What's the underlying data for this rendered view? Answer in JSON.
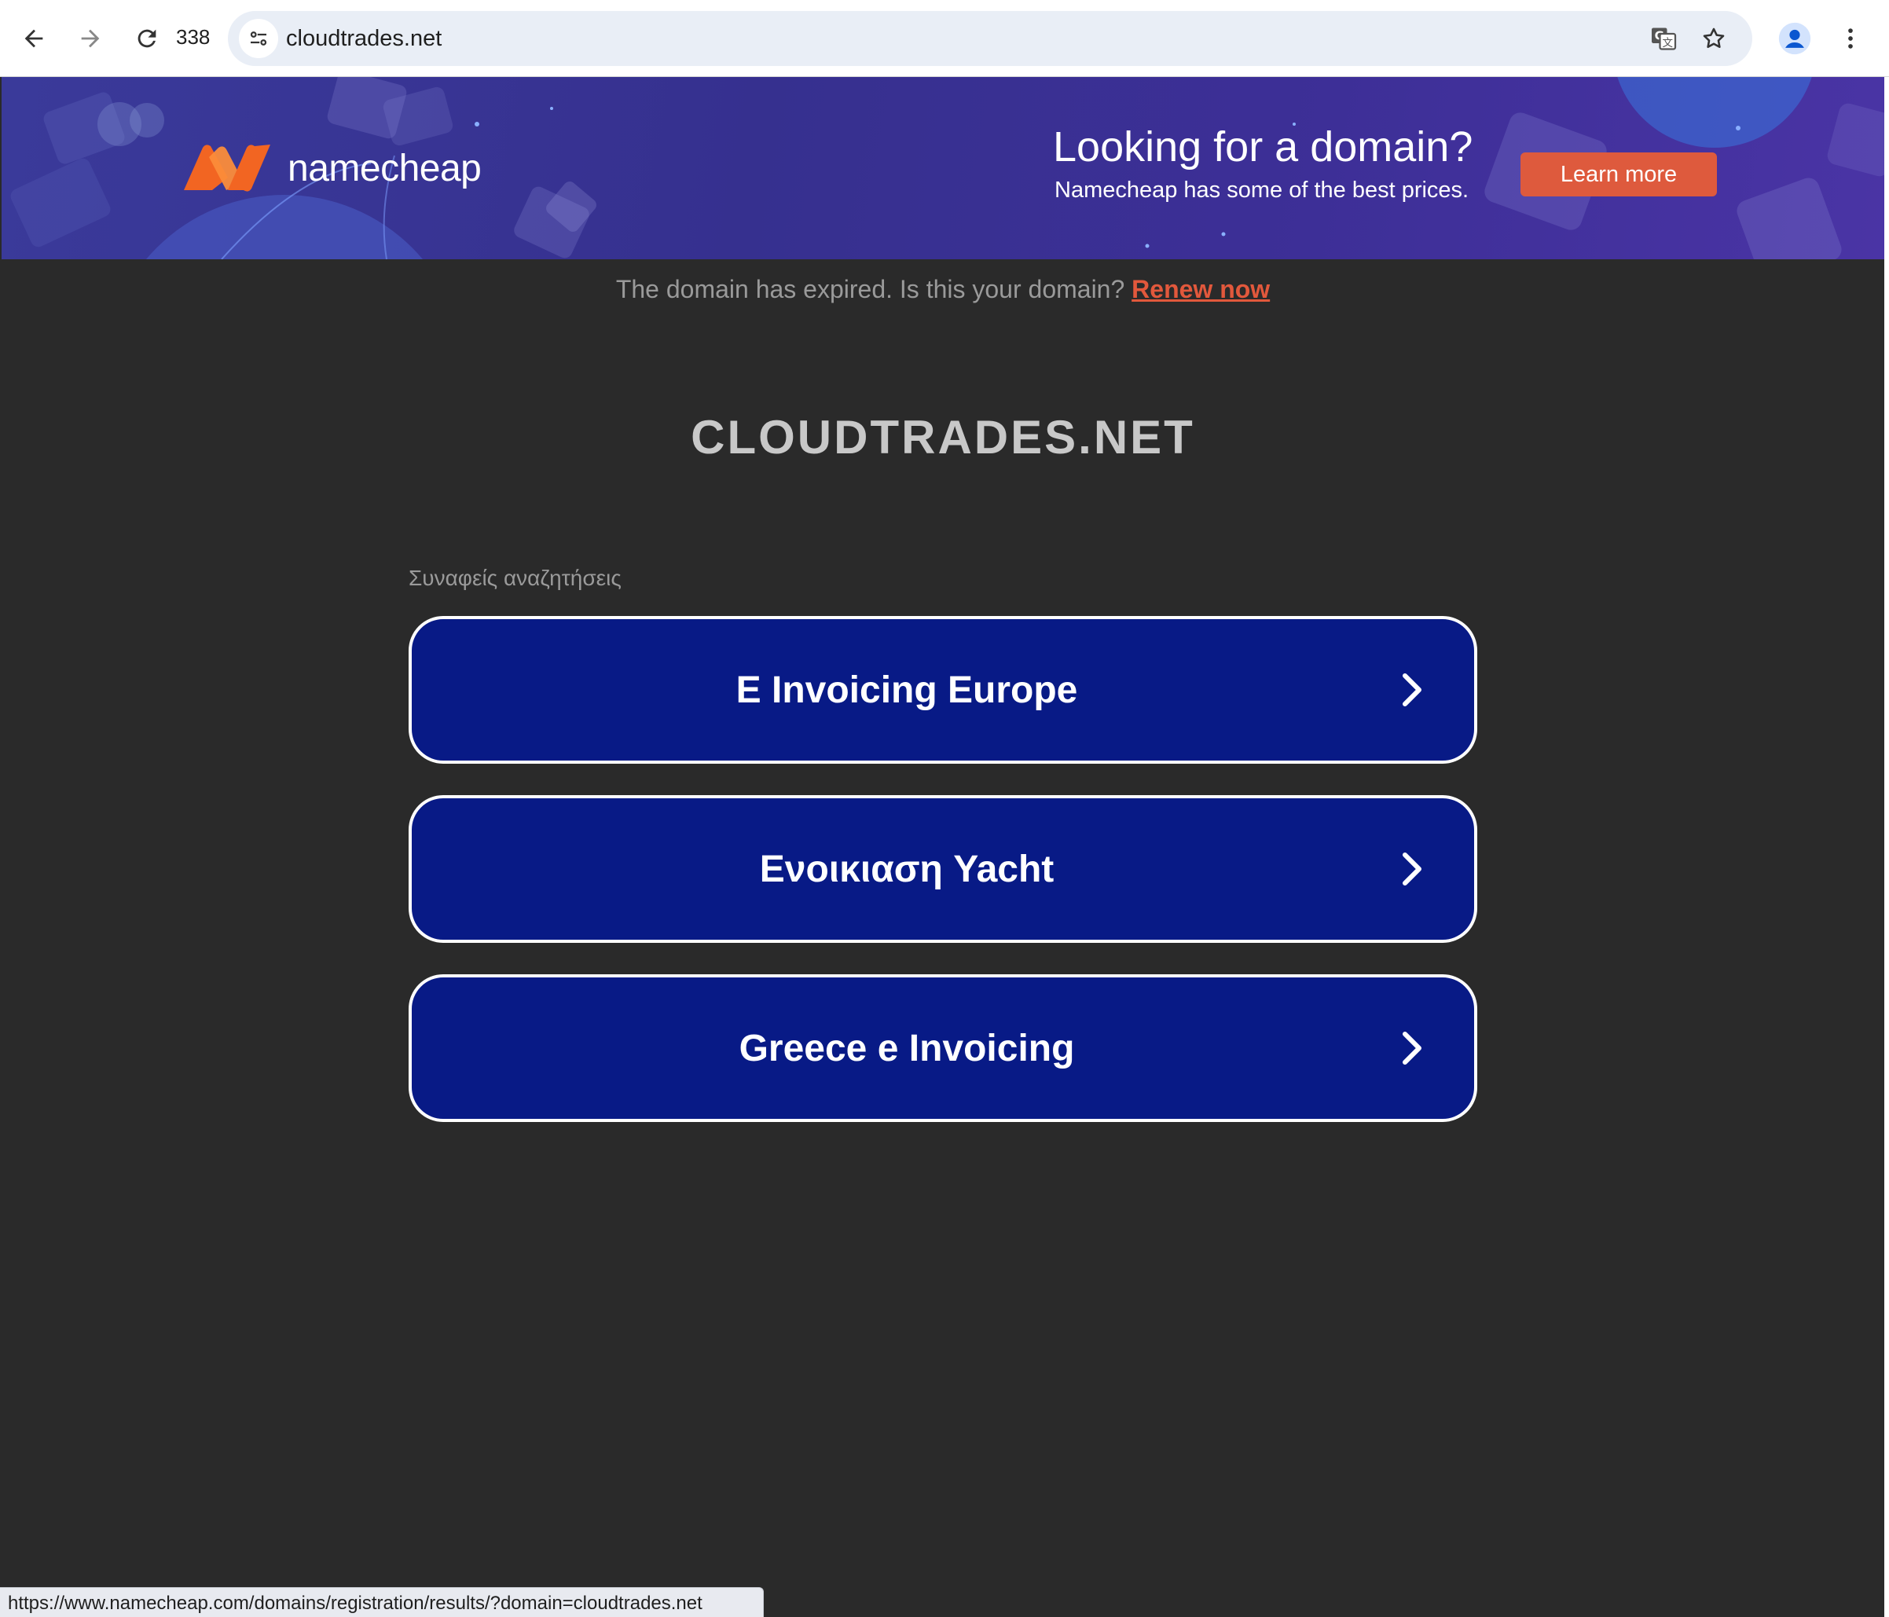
{
  "browser": {
    "reload_count": "338",
    "url": "cloudtrades.net",
    "status_url": "https://www.namecheap.com/domains/registration/results/?domain=cloudtrades.net",
    "icons": [
      "back-arrow-icon",
      "forward-arrow-icon",
      "reload-icon",
      "site-info-icon",
      "translate-icon",
      "bookmark-star-icon",
      "profile-icon",
      "menu-kebab-icon"
    ]
  },
  "banner": {
    "brand": "namecheap",
    "title": "Looking for a domain?",
    "subtitle": "Namecheap has some of the best prices.",
    "cta_label": "Learn more",
    "colors": {
      "background": "#3a3a9a",
      "cta": "#de5a3d",
      "logo": "#f26522"
    }
  },
  "notice": {
    "text": "The domain has expired. Is this your domain?",
    "link_label": "Renew now"
  },
  "page": {
    "domain_title": "CLOUDTRADES.NET",
    "related_label": "Συναφείς αναζητήσεις",
    "results": [
      {
        "label": "E Invoicing Europe"
      },
      {
        "label": "Ενοικιαση Yacht"
      },
      {
        "label": "Greece e Invoicing"
      }
    ],
    "colors": {
      "background": "#2a2a2a",
      "button": "#081a86",
      "link": "#e2583c"
    }
  }
}
